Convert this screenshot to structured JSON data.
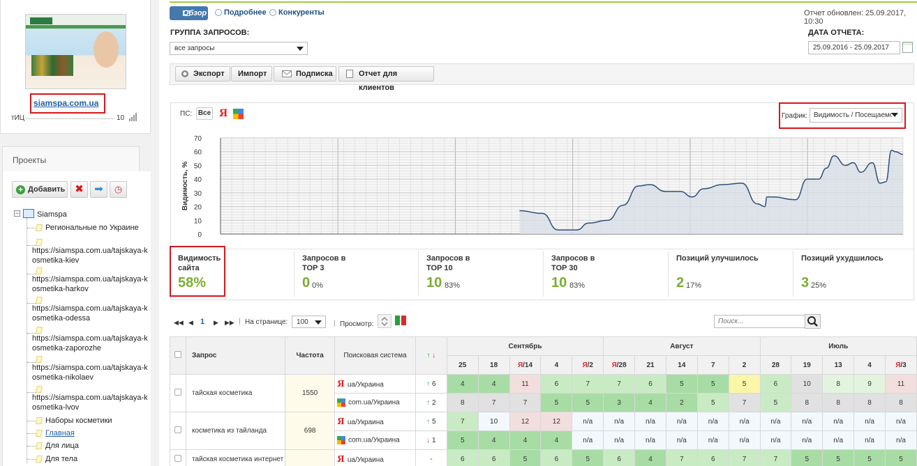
{
  "site": {
    "domain": "siamspa.com.ua",
    "tic_label": "тИЦ",
    "tic_value": "10"
  },
  "projects": {
    "title": "Проекты",
    "add_label": "Добавить",
    "root": "Siamspa",
    "items": [
      "Региональные по Украине",
      "https://siamspa.com.ua/tajskaya-kosmetika-kiev",
      "https://siamspa.com.ua/tajskaya-kosmetika-harkov",
      "https://siamspa.com.ua/tajskaya-kosmetika-odessa",
      "https://siamspa.com.ua/tajskaya-kosmetika-zaporozhe",
      "https://siamspa.com.ua/tajskaya-kosmetika-nikolaev",
      "https://siamspa.com.ua/tajskaya-kosmetika-lvov",
      "Наборы косметики",
      "Главная",
      "Для лица",
      "Для тела"
    ]
  },
  "tabs": {
    "overview": "Обзор",
    "detail": "Подробнее",
    "competitors": "Конкуренты"
  },
  "report_updated": "Отчет обновлен: 25.09.2017, 10:30",
  "filters": {
    "group_label": "ГРУППА ЗАПРОСОВ:",
    "group_value": "все запросы",
    "date_label": "ДАТА ОТЧЕТА:",
    "date_value": "25.09.2016 - 25.09.2017"
  },
  "toolbar": {
    "export": "Экспорт",
    "import": "Импорт",
    "subscribe": "Подписка",
    "clients": "Отчет для клиентов"
  },
  "chart_panel": {
    "ps_label": "ПС:",
    "ps_all": "Все",
    "ps_yandex": "Я",
    "graph_label": "График:",
    "graph_value": "Видимость / Посещаемость"
  },
  "chart_data": {
    "type": "area",
    "ylabel": "Видимость, %",
    "ylim": [
      0,
      70
    ],
    "yticks": [
      0,
      10,
      20,
      30,
      40,
      50,
      60,
      70
    ],
    "x": [
      0.0,
      0.06,
      0.1,
      0.15,
      0.18,
      0.23,
      0.27,
      0.31,
      0.34,
      0.38,
      0.42,
      0.45,
      0.48,
      0.53,
      0.58,
      0.62,
      0.64,
      0.645,
      0.66,
      0.72,
      0.75,
      0.78,
      0.8,
      0.82,
      0.85,
      0.87,
      0.89,
      0.92,
      0.94,
      0.955,
      0.97,
      0.98,
      1.0
    ],
    "y": [
      17,
      15,
      3,
      3,
      8,
      10,
      21,
      35,
      36,
      31,
      31,
      27,
      33,
      36,
      37,
      22,
      20,
      27,
      27,
      25,
      40,
      40,
      48,
      57,
      50,
      52,
      45,
      52,
      37,
      38,
      61,
      60,
      58
    ]
  },
  "metrics": [
    {
      "label": "Видимость сайта",
      "value": "58%",
      "pct": ""
    },
    {
      "label": "Запросов в ТОР 3",
      "value": "0",
      "pct": "0%"
    },
    {
      "label": "Запросов в ТОР 10",
      "value": "10",
      "pct": "83%"
    },
    {
      "label": "Запросов в ТОР 30",
      "value": "10",
      "pct": "83%"
    },
    {
      "label": "Позиций улучшилось",
      "value": "2",
      "pct": "17%"
    },
    {
      "label": "Позиций ухудшилось",
      "value": "3",
      "pct": "25%"
    }
  ],
  "pager": {
    "page": "1",
    "per_page_label": "На странице:",
    "per_page": "100",
    "view_label": "Просмотр:",
    "search_placeholder": "Поиск..."
  },
  "table": {
    "headers": {
      "query": "Запрос",
      "freq": "Частота",
      "engine": "Поисковая система",
      "trend": "↑ ↓"
    },
    "months": [
      "Сентябрь",
      "Август",
      "Июль"
    ],
    "days": [
      "25",
      "18",
      "Я/14",
      "4",
      "Я/2",
      "Я/28",
      "21",
      "14",
      "7",
      "2",
      "28",
      "19",
      "13",
      "4",
      "Я/3"
    ],
    "rows": [
      {
        "query": "тайская косметика",
        "freq": "1550",
        "engines": [
          {
            "engine": "yandex",
            "region": "ua/Украина",
            "trend": "6",
            "dir": "up",
            "cells": [
              "4",
              "4",
              "11",
              "6",
              "7",
              "7",
              "6",
              "5",
              "5",
              "5",
              "6",
              "10",
              "8",
              "9",
              "11"
            ],
            "colors": [
              "g1",
              "g1",
              "p",
              "g2",
              "g2",
              "g2",
              "g2",
              "g1",
              "g1",
              "y",
              "g2",
              "gr",
              "g3",
              "g3",
              "p"
            ]
          },
          {
            "engine": "google",
            "region": "com.ua/Украина",
            "trend": "2",
            "dir": "up",
            "cells": [
              "8",
              "7",
              "7",
              "5",
              "5",
              "3",
              "4",
              "2",
              "5",
              "7",
              "5",
              "8",
              "8",
              "8",
              "8"
            ],
            "colors": [
              "gr",
              "gr",
              "gr",
              "g1",
              "g1",
              "g1",
              "g1",
              "g1",
              "g2",
              "gr",
              "g2",
              "gr",
              "gr",
              "gr",
              "gr"
            ]
          }
        ]
      },
      {
        "query": "косметика из тайланда",
        "freq": "698",
        "engines": [
          {
            "engine": "yandex",
            "region": "ua/Украина",
            "trend": "5",
            "dir": "up",
            "cells": [
              "7",
              "10",
              "12",
              "12",
              "n/a",
              "n/a",
              "n/a",
              "n/a",
              "n/a",
              "n/a",
              "n/a",
              "n/a",
              "n/a",
              "n/a",
              "n/a"
            ],
            "colors": [
              "g2",
              "na",
              "p",
              "p",
              "na",
              "na",
              "na",
              "na",
              "na",
              "na",
              "na",
              "na",
              "na",
              "na",
              "na"
            ]
          },
          {
            "engine": "google",
            "region": "com.ua/Украина",
            "trend": "1",
            "dir": "dn",
            "cells": [
              "5",
              "4",
              "4",
              "4",
              "n/a",
              "n/a",
              "n/a",
              "n/a",
              "n/a",
              "n/a",
              "n/a",
              "n/a",
              "n/a",
              "n/a",
              "n/a"
            ],
            "colors": [
              "g1",
              "g1",
              "g1",
              "g1",
              "na",
              "na",
              "na",
              "na",
              "na",
              "na",
              "na",
              "na",
              "na",
              "na",
              "na"
            ]
          }
        ]
      },
      {
        "query": "тайская косметика интернет",
        "freq": "",
        "engines": [
          {
            "engine": "yandex",
            "region": "ua/Украина",
            "trend": "-",
            "dir": "none",
            "cells": [
              "6",
              "6",
              "5",
              "6",
              "5",
              "6",
              "4",
              "7",
              "6",
              "7",
              "7",
              "5",
              "5",
              "5",
              "5"
            ],
            "colors": [
              "g2",
              "g2",
              "g1",
              "g2",
              "g1",
              "g2",
              "g1",
              "g2",
              "g2",
              "g2",
              "g2",
              "g1",
              "g1",
              "g1",
              "g1"
            ]
          }
        ]
      }
    ]
  }
}
